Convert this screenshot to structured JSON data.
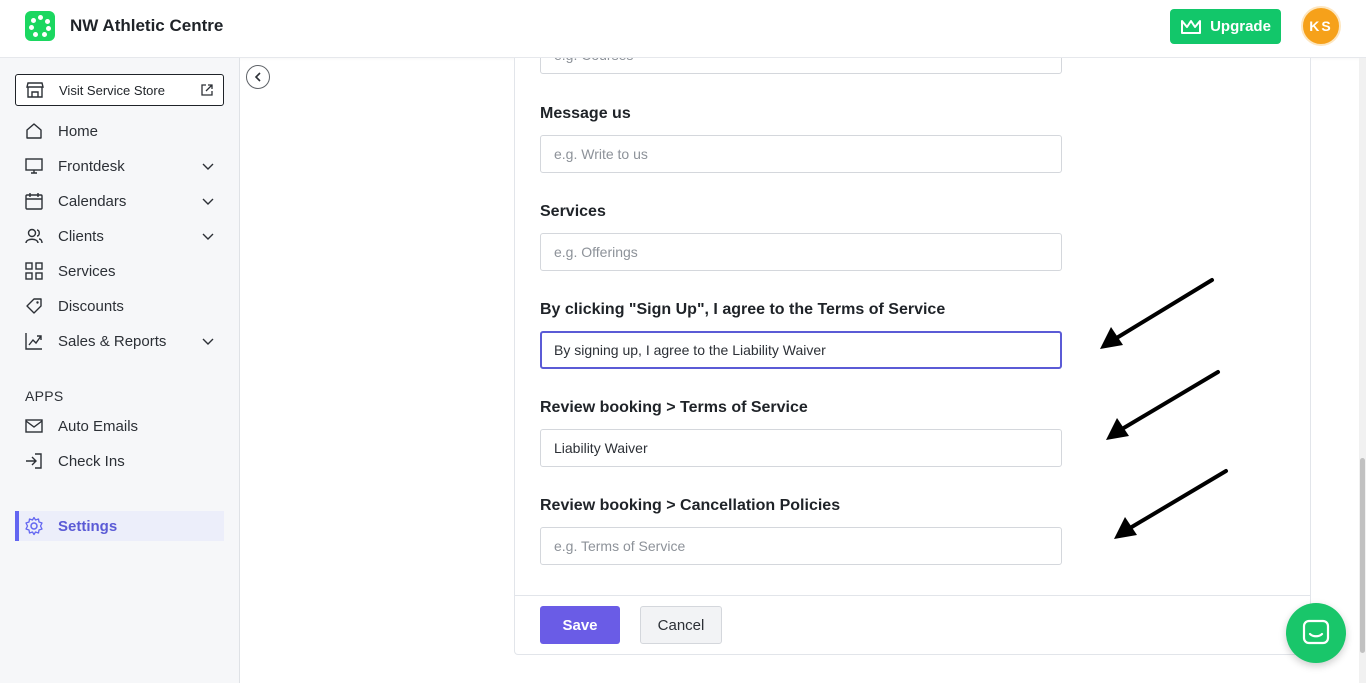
{
  "header": {
    "brand": "NW Athletic Centre",
    "upgrade_label": "Upgrade",
    "avatar_initials": "KS",
    "brand_color": "#1bd760",
    "upgrade_color": "#12c76a",
    "avatar_color": "#f6a11a"
  },
  "sidebar": {
    "store_label": "Visit Service Store",
    "items": [
      {
        "label": "Home",
        "icon": "home-icon"
      },
      {
        "label": "Frontdesk",
        "icon": "monitor-icon",
        "has_children": true
      },
      {
        "label": "Calendars",
        "icon": "calendar-icon",
        "has_children": true
      },
      {
        "label": "Clients",
        "icon": "users-icon",
        "has_children": true
      },
      {
        "label": "Services",
        "icon": "grid-icon"
      },
      {
        "label": "Discounts",
        "icon": "tag-icon"
      },
      {
        "label": "Sales & Reports",
        "icon": "chart-icon",
        "has_children": true
      }
    ],
    "apps_heading": "APPS",
    "apps": [
      {
        "label": "Auto Emails",
        "icon": "mail-icon"
      },
      {
        "label": "Check Ins",
        "icon": "login-icon"
      }
    ],
    "settings_label": "Settings",
    "active_color": "#6366f1"
  },
  "form": {
    "top_partial_placeholder": "e.g. Courses",
    "fields": [
      {
        "label": "Message us",
        "value": "",
        "placeholder": "e.g. Write to us"
      },
      {
        "label": "Services",
        "value": "",
        "placeholder": "e.g. Offerings"
      },
      {
        "label": "By clicking \"Sign Up\", I agree to the Terms of Service",
        "value": "By signing up, I agree to the Liability Waiver",
        "placeholder": "",
        "focused": true
      },
      {
        "label": "Review booking > Terms of Service",
        "value": "Liability Waiver",
        "placeholder": ""
      },
      {
        "label": "Review booking > Cancellation Policies",
        "value": "",
        "placeholder": "e.g. Terms of Service"
      }
    ],
    "save_label": "Save",
    "cancel_label": "Cancel",
    "save_color": "#6a5ce6"
  }
}
